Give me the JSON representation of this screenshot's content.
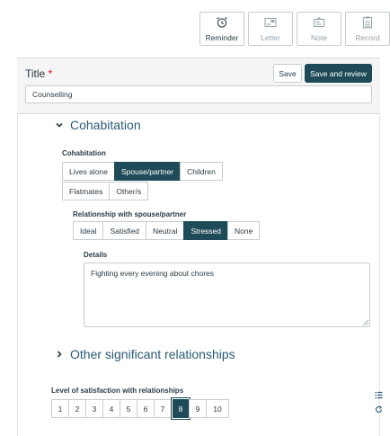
{
  "toolbar": {
    "items": [
      {
        "label": "Reminder",
        "icon": "alarm-clock-icon",
        "active": true
      },
      {
        "label": "Letter",
        "icon": "letter-icon",
        "active": false
      },
      {
        "label": "Note",
        "icon": "note-icon",
        "active": false
      },
      {
        "label": "Record",
        "icon": "record-icon",
        "active": false
      }
    ]
  },
  "form": {
    "title_label": "Title",
    "required_mark": "*",
    "save_label": "Save",
    "save_review_label": "Save and review",
    "title_value": "Counselling"
  },
  "cohabitation": {
    "section_title": "Cohabitation",
    "field_label": "Cohabitation",
    "options_row1": [
      "Lives alone",
      "Spouse/partner",
      "Children"
    ],
    "options_row2": [
      "Flatmates",
      "Other/s"
    ],
    "selected": "Spouse/partner",
    "relationship_label": "Relationship with spouse/partner",
    "relationship_options": [
      "Ideal",
      "Satisfied",
      "Neutral",
      "Stressed",
      "None"
    ],
    "relationship_selected": "Stressed",
    "details_label": "Details",
    "details_value": "Fighting every evening about chores"
  },
  "other_relationships": {
    "section_title": "Other significant relationships"
  },
  "satisfaction": {
    "label": "Level of satisfaction with relationships",
    "options": [
      "1",
      "2",
      "3",
      "4",
      "5",
      "6",
      "7",
      "8",
      "9",
      "10"
    ],
    "selected": "8"
  },
  "colors": {
    "accent": "#1f4b59",
    "section_heading": "#2a5b75",
    "required": "#e0061f"
  },
  "side_icons": [
    "list-icon",
    "refresh-icon"
  ]
}
